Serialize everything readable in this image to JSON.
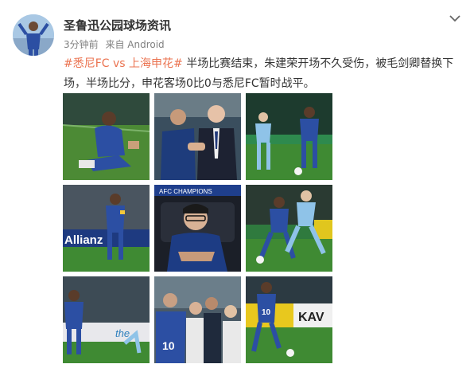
{
  "author": {
    "name": "圣鲁迅公园球场资讯"
  },
  "meta": {
    "time": "3分钟前",
    "source": "来自 Android"
  },
  "post": {
    "tag": "#悉尼FC vs 上海申花#",
    "text": " 半场比赛结束，朱建荣开场不久受伤，被毛剑卿替换下场，半场比分，申花客场0比0与悉尼FC暂时战平。"
  },
  "photos": [
    {
      "subject": "injured-player-on-grass"
    },
    {
      "subject": "coaches-handshake"
    },
    {
      "subject": "player-dribbling-stadium"
    },
    {
      "subject": "player-captain-armband"
    },
    {
      "subject": "coach-in-dugout"
    },
    {
      "subject": "players-challenge-ball"
    },
    {
      "subject": "player-near-ad-board"
    },
    {
      "subject": "players-on-sideline"
    },
    {
      "subject": "player-running-with-ball"
    }
  ],
  "photo_text": {
    "allianz": "Allianz",
    "kawai": "KAV",
    "the": "the",
    "number10": "10",
    "number10b": "10",
    "acl": "AFC CHAMPIONS"
  },
  "colors": {
    "tag": "#eb7350",
    "name": "#333333",
    "meta": "#808080",
    "shenhua_blue": "#2c4fa3",
    "sydney_sky": "#8fc3e8",
    "pitch_green": "#3f7a2e"
  }
}
